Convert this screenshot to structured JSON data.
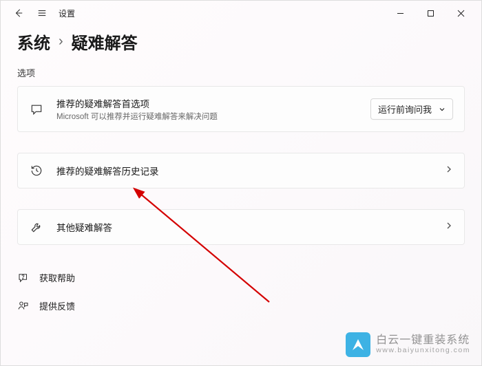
{
  "titlebar": {
    "title": "设置"
  },
  "breadcrumb": {
    "parent": "系统",
    "current": "疑难解答"
  },
  "section_label": "选项",
  "cards": {
    "preferences": {
      "title": "推荐的疑难解答首选项",
      "subtitle": "Microsoft 可以推荐并运行疑难解答来解决问题",
      "select_value": "运行前询问我"
    },
    "history": {
      "title": "推荐的疑难解答历史记录"
    },
    "other": {
      "title": "其他疑难解答"
    }
  },
  "links": {
    "help": "获取帮助",
    "feedback": "提供反馈"
  },
  "watermark": {
    "cn": "白云一键重装系统",
    "url": "www.baiyunxitong.com"
  }
}
